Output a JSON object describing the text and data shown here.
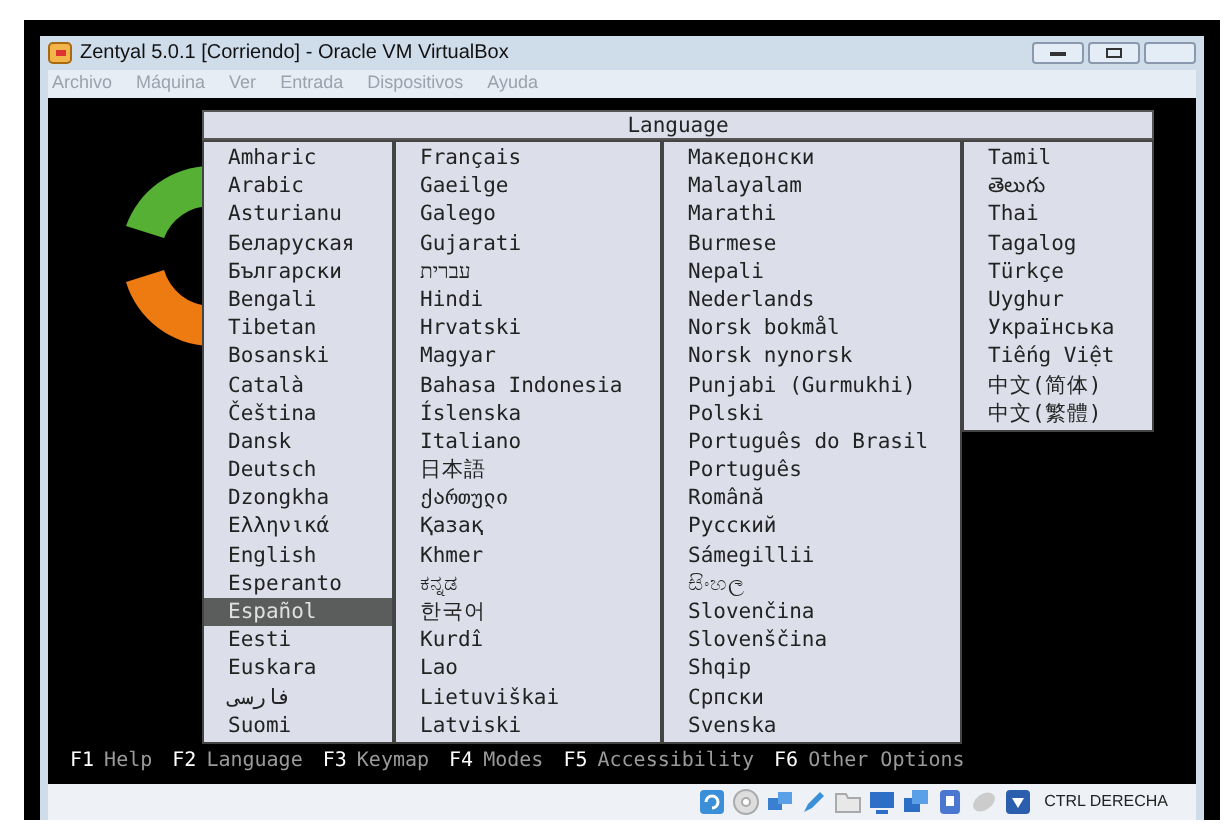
{
  "window": {
    "title": "Zentyal 5.0.1 [Corriendo] - Oracle VM VirtualBox"
  },
  "menu": [
    "Archivo",
    "Máquina",
    "Ver",
    "Entrada",
    "Dispositivos",
    "Ayuda"
  ],
  "dialog": {
    "title": "Language",
    "columns": [
      [
        {
          "label": "Amharic",
          "selected": false
        },
        {
          "label": "Arabic",
          "selected": false
        },
        {
          "label": "Asturianu",
          "selected": false
        },
        {
          "label": "Беларуская",
          "selected": false
        },
        {
          "label": "Български",
          "selected": false
        },
        {
          "label": "Bengali",
          "selected": false
        },
        {
          "label": "Tibetan",
          "selected": false
        },
        {
          "label": "Bosanski",
          "selected": false
        },
        {
          "label": "Català",
          "selected": false
        },
        {
          "label": "Čeština",
          "selected": false
        },
        {
          "label": "Dansk",
          "selected": false
        },
        {
          "label": "Deutsch",
          "selected": false
        },
        {
          "label": "Dzongkha",
          "selected": false
        },
        {
          "label": "Ελληνικά",
          "selected": false
        },
        {
          "label": "English",
          "selected": false
        },
        {
          "label": "Esperanto",
          "selected": false
        },
        {
          "label": "Español",
          "selected": true
        },
        {
          "label": "Eesti",
          "selected": false
        },
        {
          "label": "Euskara",
          "selected": false
        },
        {
          "label": "فارسی",
          "selected": false
        },
        {
          "label": "Suomi",
          "selected": false
        }
      ],
      [
        {
          "label": "Français",
          "selected": false
        },
        {
          "label": "Gaeilge",
          "selected": false
        },
        {
          "label": "Galego",
          "selected": false
        },
        {
          "label": "Gujarati",
          "selected": false
        },
        {
          "label": "עברית",
          "selected": false
        },
        {
          "label": "Hindi",
          "selected": false
        },
        {
          "label": "Hrvatski",
          "selected": false
        },
        {
          "label": "Magyar",
          "selected": false
        },
        {
          "label": "Bahasa Indonesia",
          "selected": false
        },
        {
          "label": "Íslenska",
          "selected": false
        },
        {
          "label": "Italiano",
          "selected": false
        },
        {
          "label": "日本語",
          "selected": false
        },
        {
          "label": "ქართული",
          "selected": false
        },
        {
          "label": "Қазақ",
          "selected": false
        },
        {
          "label": "Khmer",
          "selected": false
        },
        {
          "label": "ಕನ್ನಡ",
          "selected": false
        },
        {
          "label": "한국어",
          "selected": false
        },
        {
          "label": "Kurdî",
          "selected": false
        },
        {
          "label": "Lao",
          "selected": false
        },
        {
          "label": "Lietuviškai",
          "selected": false
        },
        {
          "label": "Latviski",
          "selected": false
        }
      ],
      [
        {
          "label": "Македонски",
          "selected": false
        },
        {
          "label": "Malayalam",
          "selected": false
        },
        {
          "label": "Marathi",
          "selected": false
        },
        {
          "label": "Burmese",
          "selected": false
        },
        {
          "label": "Nepali",
          "selected": false
        },
        {
          "label": "Nederlands",
          "selected": false
        },
        {
          "label": "Norsk bokmål",
          "selected": false
        },
        {
          "label": "Norsk nynorsk",
          "selected": false
        },
        {
          "label": "Punjabi (Gurmukhi)",
          "selected": false
        },
        {
          "label": "Polski",
          "selected": false
        },
        {
          "label": "Português do Brasil",
          "selected": false
        },
        {
          "label": "Português",
          "selected": false
        },
        {
          "label": "Română",
          "selected": false
        },
        {
          "label": "Русский",
          "selected": false
        },
        {
          "label": "Sámegillii",
          "selected": false
        },
        {
          "label": "සිංහල",
          "selected": false
        },
        {
          "label": "Slovenčina",
          "selected": false
        },
        {
          "label": "Slovenščina",
          "selected": false
        },
        {
          "label": "Shqip",
          "selected": false
        },
        {
          "label": "Српски",
          "selected": false
        },
        {
          "label": "Svenska",
          "selected": false
        }
      ],
      [
        {
          "label": "Tamil",
          "selected": false
        },
        {
          "label": "తెలుగు",
          "selected": false
        },
        {
          "label": "Thai",
          "selected": false
        },
        {
          "label": "Tagalog",
          "selected": false
        },
        {
          "label": "Türkçe",
          "selected": false
        },
        {
          "label": "Uyghur",
          "selected": false
        },
        {
          "label": "Українська",
          "selected": false
        },
        {
          "label": "Tiếng Việt",
          "selected": false
        },
        {
          "label": "中文(简体)",
          "selected": false
        },
        {
          "label": "中文(繁體)",
          "selected": false
        }
      ]
    ]
  },
  "function_keys": [
    {
      "key": "F1",
      "label": "Help"
    },
    {
      "key": "F2",
      "label": "Language"
    },
    {
      "key": "F3",
      "label": "Keymap"
    },
    {
      "key": "F4",
      "label": "Modes"
    },
    {
      "key": "F5",
      "label": "Accessibility"
    },
    {
      "key": "F6",
      "label": "Other Options"
    }
  ],
  "status_bar": {
    "host_key": "CTRL DERECHA"
  }
}
